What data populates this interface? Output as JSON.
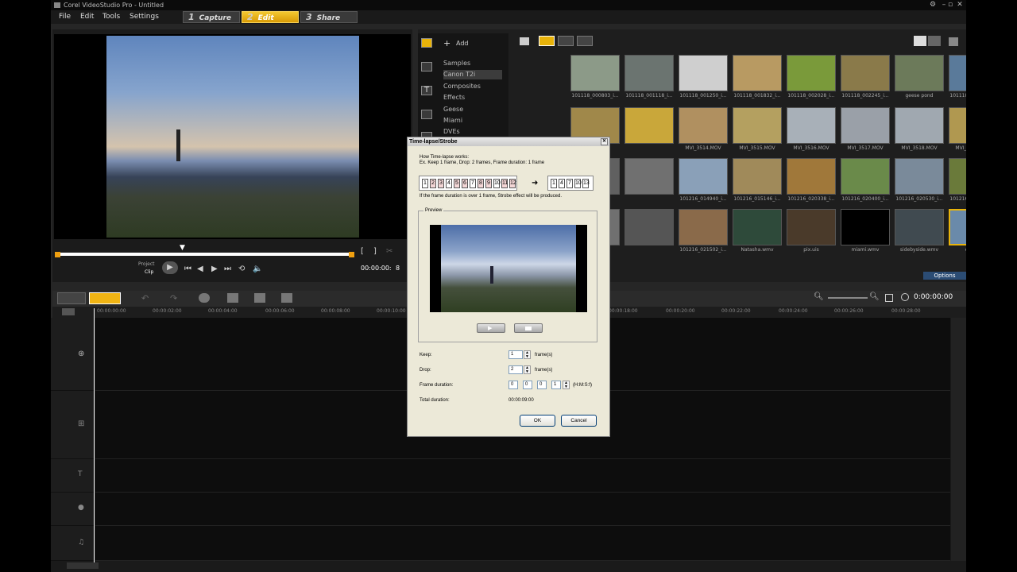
{
  "window": {
    "title": "Corel VideoStudio Pro - Untitled"
  },
  "menu": [
    "File",
    "Edit",
    "Tools",
    "Settings"
  ],
  "steps": [
    {
      "num": "1",
      "label": "Capture"
    },
    {
      "num": "2",
      "label": "Edit"
    },
    {
      "num": "3",
      "label": "Share"
    }
  ],
  "player": {
    "mode_project": "Project",
    "mode_clip": "Clip",
    "timecode": "00:00:00:",
    "timecode_end": "8"
  },
  "library": {
    "add_label": "Add",
    "folders": [
      "Samples",
      "Canon T2i",
      "Composites",
      "Effects",
      "Geese",
      "Miami",
      "DVEs"
    ],
    "selected_folder": "Canon T2i",
    "options_label": "Options",
    "thumbnails": [
      [
        "101118_000803_i...",
        "101118_001118_i...",
        "101118_001250_i...",
        "101118_001832_i...",
        "101118_002028_i...",
        "101118_002245_i...",
        "geese pond",
        "101118_002740_i..."
      ],
      [
        "",
        "",
        "MVI_3514.MOV",
        "MVI_3515.MOV",
        "MVI_3516.MOV",
        "MVI_3517.MOV",
        "MVI_3518.MOV",
        "MVI_3519.MOV"
      ],
      [
        "",
        "",
        "101216_014940_i...",
        "101216_015146_i...",
        "101216_020338_i...",
        "101216_020400_i...",
        "101216_020530_i...",
        "101216_020712_i..."
      ],
      [
        "",
        "",
        "101216_021502_i...",
        "Natasha.wmv",
        "pix.uis",
        "miami.wmv",
        "sidebyside.wmv",
        "city.uis"
      ]
    ]
  },
  "timeline": {
    "ticks": [
      "00:00:00:00",
      "00:00:02:00",
      "00:00:04:00",
      "00:00:06:00",
      "00:00:08:00",
      "00:00:10:00",
      "00:00:18:00",
      "00:00:20:00",
      "00:00:22:00",
      "00:00:24:00",
      "00:00:26:00",
      "00:00:28:00"
    ],
    "timecode": "0:00:00:00"
  },
  "dialog": {
    "title": "Time-lapse/Strobe",
    "how_works": "How Time-lapse works:",
    "example": "Ex. Keep 1 frame, Drop: 2 frames, Frame duration: 1 frame",
    "film_in": [
      "1",
      "2",
      "3",
      "4",
      "5",
      "6",
      "7",
      "8",
      "9",
      "10",
      "11",
      "12"
    ],
    "film_out": [
      "1",
      "4",
      "7",
      "10",
      "13"
    ],
    "strobe_note": "If the frame duration is over 1 frame, Strobe effect will be produced.",
    "preview_label": "Preview",
    "keep_label": "Keep:",
    "keep_value": "1",
    "drop_label": "Drop:",
    "drop_value": "2",
    "frames_unit": "frame(s)",
    "frame_duration_label": "Frame duration:",
    "fd_h": "0",
    "fd_m": "0",
    "fd_s": "0",
    "fd_f": "1",
    "hmsf": "(H:M:S:f)",
    "total_duration_label": "Total duration:",
    "total_duration_value": "00:00:09:00",
    "ok_label": "OK",
    "cancel_label": "Cancel"
  },
  "colors": {
    "accent": "#f0b414",
    "dialog_bg": "#ece9d8",
    "app_bg": "#262626"
  }
}
